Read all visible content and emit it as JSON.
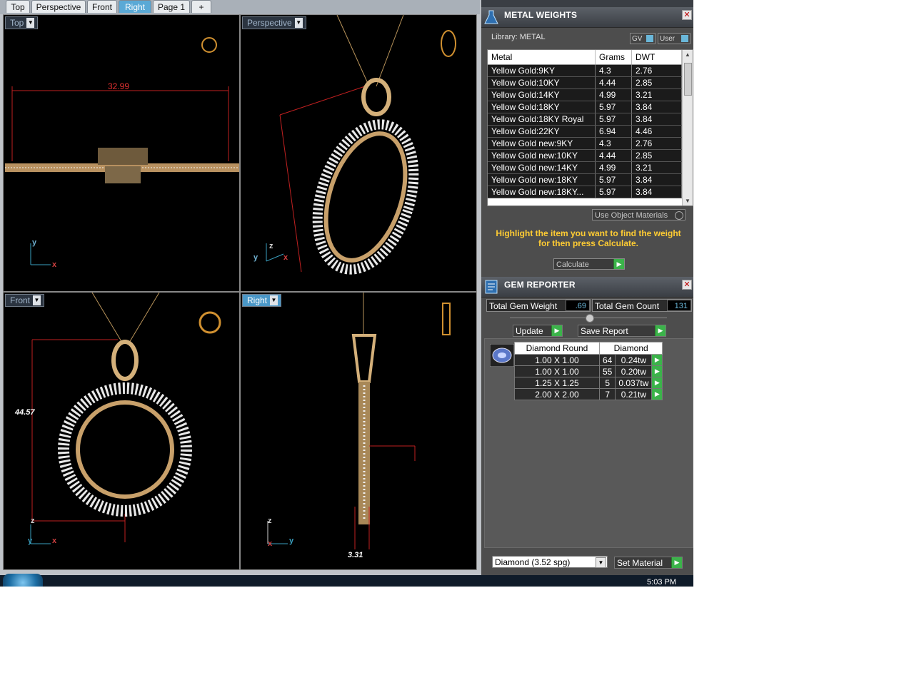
{
  "tabs": [
    "Top",
    "Perspective",
    "Front",
    "Right",
    "Page 1",
    "+"
  ],
  "active_tab": "Right",
  "viewports": {
    "top": {
      "label": "Top",
      "dimension": "32.99",
      "axis_y": "y",
      "axis_x": "x"
    },
    "perspective": {
      "label": "Perspective",
      "axis_y": "y",
      "axis_x": "x",
      "axis_z": "z"
    },
    "front": {
      "label": "Front",
      "dimension": "44.57",
      "axis_z": "z",
      "axis_y": "y",
      "axis_x": "x"
    },
    "right": {
      "label": "Right",
      "dimension": "3.31",
      "axis_z": "z",
      "axis_x": "x",
      "axis_y": "y"
    }
  },
  "metal_weights": {
    "title": "METAL WEIGHTS",
    "library_label": "Library: METAL",
    "gv_label": "GV",
    "user_label": "User",
    "columns": [
      "Metal",
      "Grams",
      "DWT"
    ],
    "rows": [
      [
        "Yellow Gold:9KY",
        "4.3",
        "2.76"
      ],
      [
        "Yellow Gold:10KY",
        "4.44",
        "2.85"
      ],
      [
        "Yellow Gold:14KY",
        "4.99",
        "3.21"
      ],
      [
        "Yellow Gold:18KY",
        "5.97",
        "3.84"
      ],
      [
        "Yellow Gold:18KY Royal",
        "5.97",
        "3.84"
      ],
      [
        "Yellow Gold:22KY",
        "6.94",
        "4.46"
      ],
      [
        "Yellow Gold new:9KY",
        "4.3",
        "2.76"
      ],
      [
        "Yellow Gold new:10KY",
        "4.44",
        "2.85"
      ],
      [
        "Yellow Gold new:14KY",
        "4.99",
        "3.21"
      ],
      [
        "Yellow Gold new:18KY",
        "5.97",
        "3.84"
      ],
      [
        "Yellow Gold new:18KY...",
        "5.97",
        "3.84"
      ]
    ],
    "use_object_materials": "Use Object Materials",
    "hint": "Highlight the item you want to find the weight for then press Calculate.",
    "calculate_label": "Calculate"
  },
  "gem_reporter": {
    "title": "GEM REPORTER",
    "total_weight_label": "Total Gem Weight",
    "total_weight_value": ".69",
    "total_count_label": "Total Gem Count",
    "total_count_value": "131",
    "update_label": "Update",
    "save_report_label": "Save Report",
    "columns": [
      "Diamond Round",
      "Diamond"
    ],
    "rows": [
      [
        "1.00 X 1.00",
        "64",
        "0.24tw"
      ],
      [
        "1.00 X 1.00",
        "55",
        "0.20tw"
      ],
      [
        "1.25 X 1.25",
        "5",
        "0.037tw"
      ],
      [
        "2.00 X 2.00",
        "7",
        "0.21tw"
      ]
    ],
    "material_select": "Diamond     (3.52 spg)",
    "set_material_label": "Set Material"
  },
  "taskbar": {
    "clock": "5:03 PM"
  }
}
